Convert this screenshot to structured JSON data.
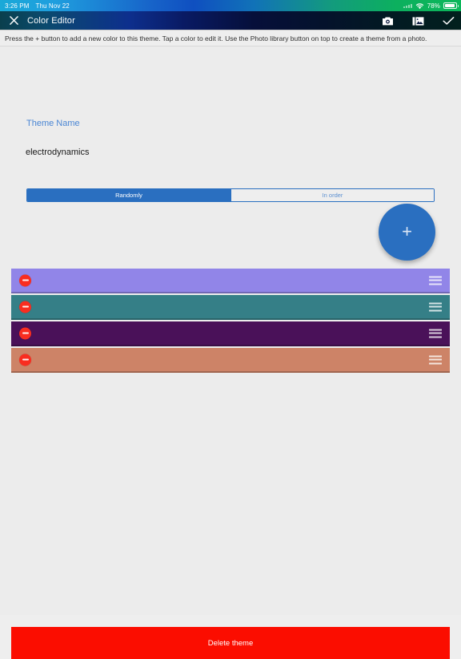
{
  "status_bar": {
    "time": "3:26 PM",
    "date": "Thu Nov 22",
    "battery_percent": "78%",
    "wifi_icon": "wifi-icon",
    "battery_icon": "battery-icon"
  },
  "nav_bar": {
    "title": "Color Editor",
    "close_icon": "close-icon",
    "camera_icon": "camera-icon",
    "photo_library_icon": "photo-library-icon",
    "confirm_icon": "checkmark-icon"
  },
  "instructions": {
    "text": "Press the + button to add a new color to this theme. Tap a color to edit it. Use the Photo library button on top to create a theme from a photo."
  },
  "theme": {
    "name_label": "Theme Name",
    "name_value": "electrodynamics"
  },
  "order_segment": {
    "options": [
      {
        "label": "Randomly",
        "selected": true
      },
      {
        "label": "In order",
        "selected": false
      }
    ]
  },
  "add_color_fab": {
    "label": "+"
  },
  "colors": [
    {
      "hex": "#9185e8",
      "delete_label": "−",
      "handle": "drag-handle-icon"
    },
    {
      "hex": "#357f87",
      "delete_label": "−",
      "handle": "drag-handle-icon"
    },
    {
      "hex": "#4a1159",
      "delete_label": "−",
      "handle": "drag-handle-icon"
    },
    {
      "hex": "#cd8367",
      "delete_label": "−",
      "handle": "drag-handle-icon"
    }
  ],
  "delete_theme": {
    "label": "Delete theme",
    "color": "#fb0d00"
  },
  "accent_color": "#2a6fc0",
  "link_color": "#4a86d4"
}
